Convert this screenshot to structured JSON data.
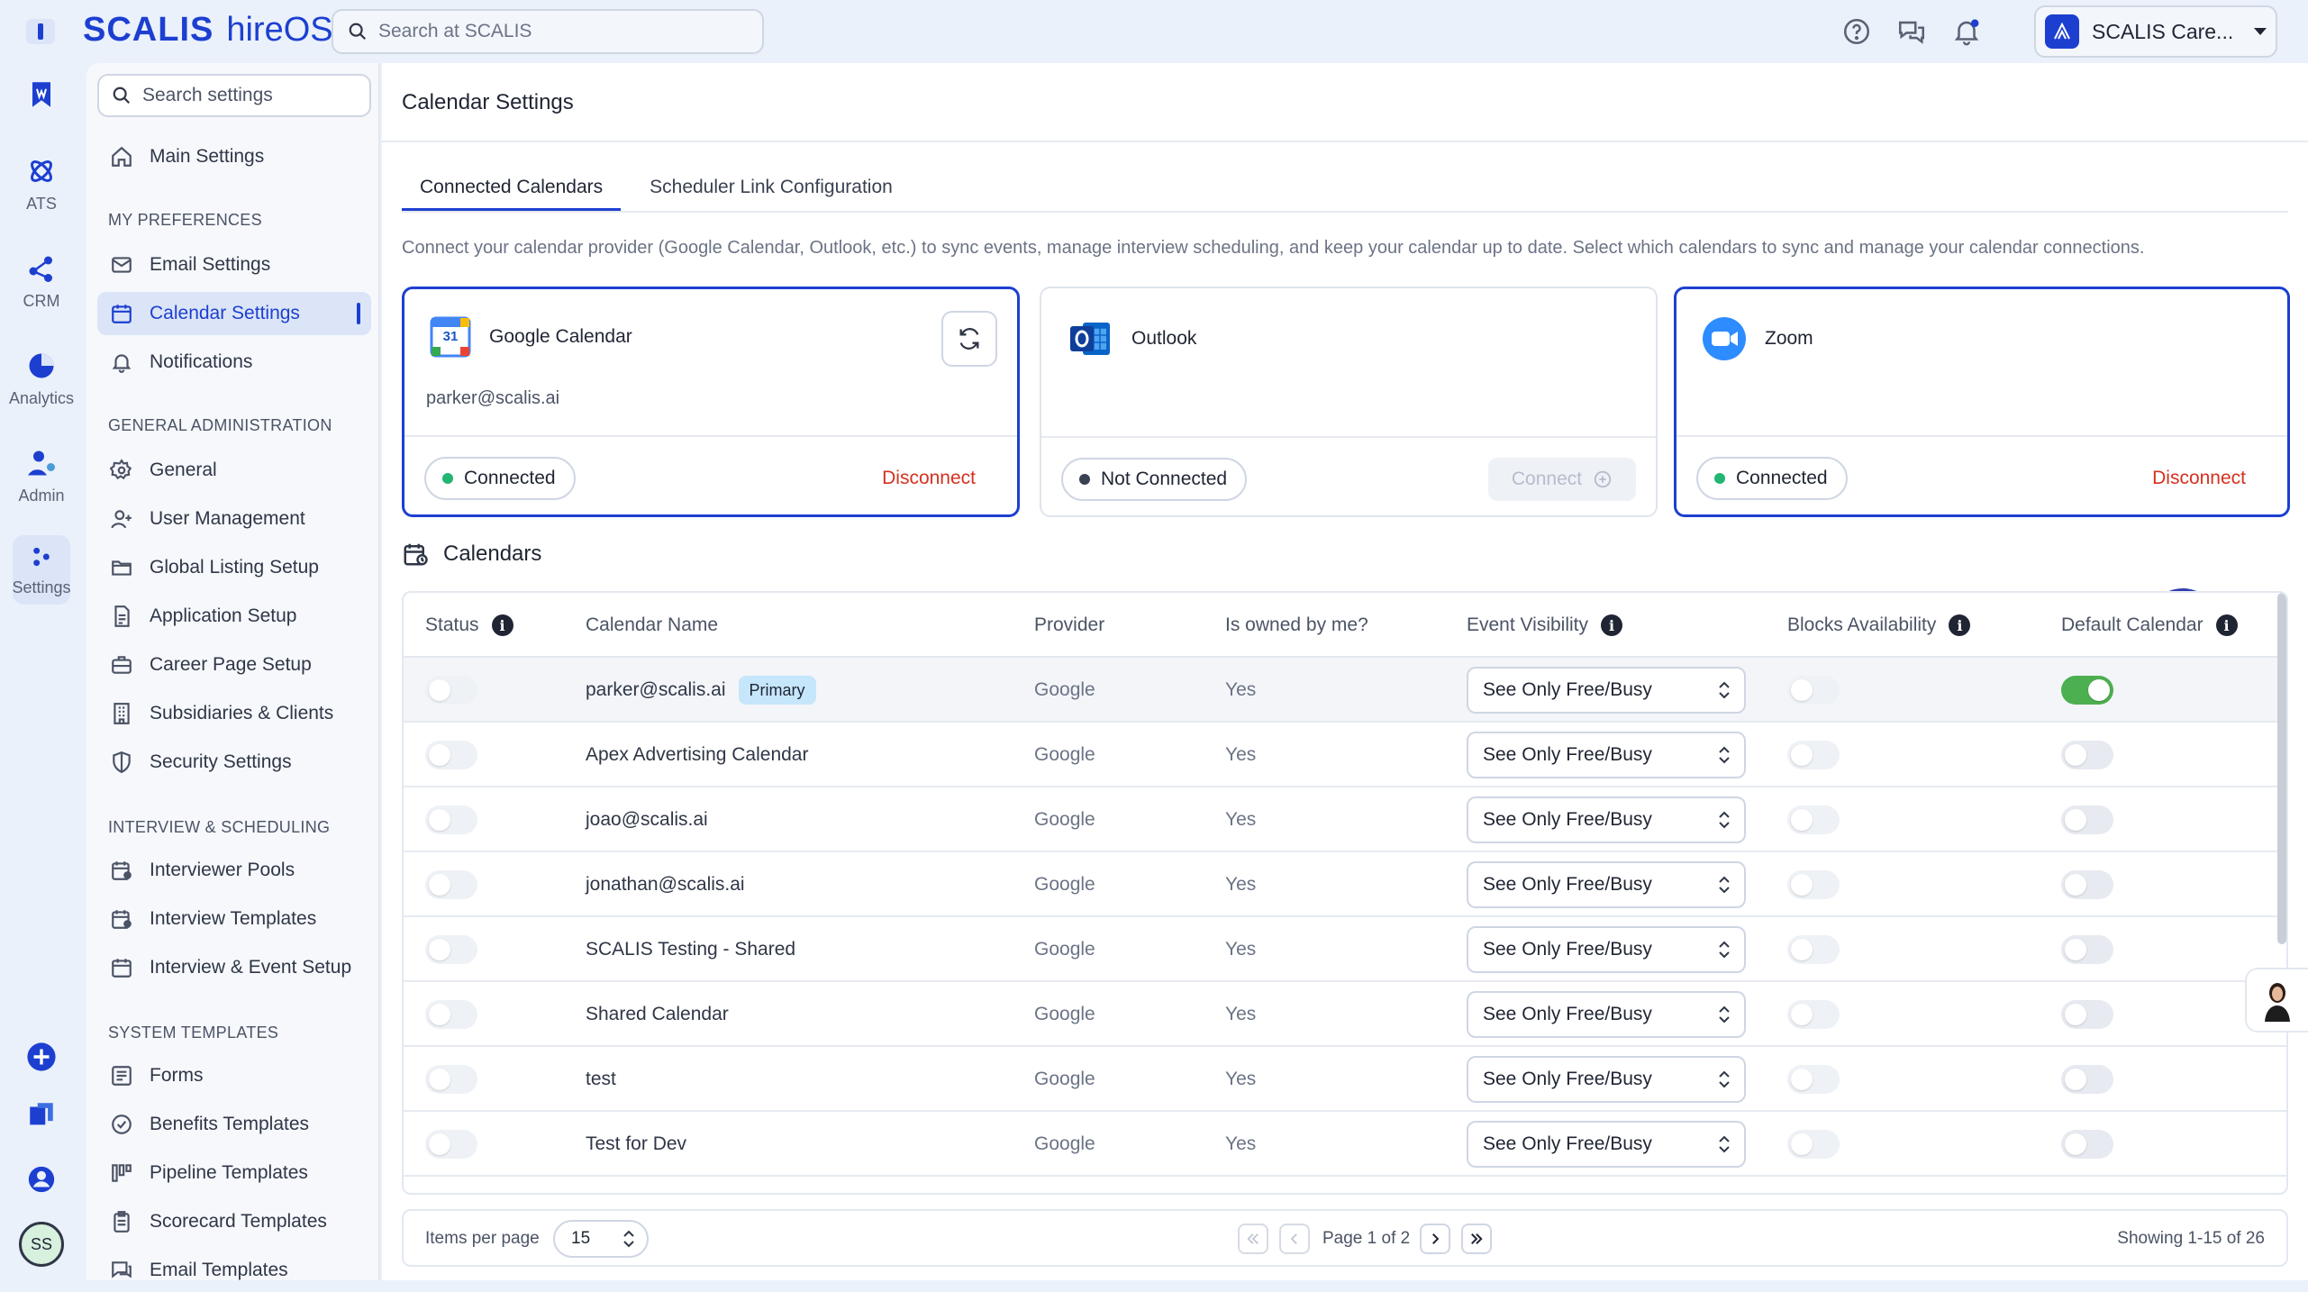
{
  "brand": {
    "name": "SCALIS",
    "product": "hireOS"
  },
  "top_search": {
    "placeholder": "Search at SCALIS"
  },
  "org": {
    "name": "SCALIS Care..."
  },
  "rail": {
    "ats": "ATS",
    "crm": "CRM",
    "analytics": "Analytics",
    "admin": "Admin",
    "settings": "Settings",
    "user_initials": "SS"
  },
  "settings_nav": {
    "search_placeholder": "Search settings",
    "main": "Main Settings",
    "sec_prefs": "MY PREFERENCES",
    "email": "Email Settings",
    "calendar": "Calendar Settings",
    "notifications": "Notifications",
    "sec_admin": "GENERAL ADMINISTRATION",
    "general": "General",
    "users": "User Management",
    "listing": "Global Listing Setup",
    "application": "Application Setup",
    "career": "Career Page Setup",
    "subsidiaries": "Subsidiaries & Clients",
    "security": "Security Settings",
    "sec_interview": "INTERVIEW & SCHEDULING",
    "pools": "Interviewer Pools",
    "int_templates": "Interview Templates",
    "event_setup": "Interview & Event Setup",
    "sec_system": "SYSTEM TEMPLATES",
    "forms": "Forms",
    "benefits": "Benefits Templates",
    "pipeline": "Pipeline Templates",
    "scorecard": "Scorecard Templates",
    "email_templates": "Email Templates"
  },
  "page": {
    "title": "Calendar Settings",
    "tab_connected": "Connected Calendars",
    "tab_scheduler": "Scheduler Link Configuration",
    "description": "Connect your calendar provider (Google Calendar, Outlook, etc.) to sync events, manage interview scheduling, and keep your calendar up to date. Select which calendars to sync and manage your calendar connections."
  },
  "providers": {
    "google": {
      "name": "Google Calendar",
      "email": "parker@scalis.ai",
      "status": "Connected",
      "action": "Disconnect",
      "icon_day": "31"
    },
    "outlook": {
      "name": "Outlook",
      "status": "Not Connected",
      "action": "Connect"
    },
    "zoom": {
      "name": "Zoom",
      "status": "Connected",
      "action": "Disconnect"
    }
  },
  "calendars": {
    "heading": "Calendars",
    "columns": {
      "status": "Status",
      "name": "Calendar Name",
      "provider": "Provider",
      "owned": "Is owned by me?",
      "visibility": "Event Visibility",
      "blocks": "Blocks Availability",
      "default": "Default Calendar"
    },
    "rows": [
      {
        "name": "parker@scalis.ai",
        "badge": "Primary",
        "provider": "Google",
        "owned": "Yes",
        "visibility": "See Only Free/Busy",
        "status_on": false,
        "blocks_on": false,
        "default_on": true
      },
      {
        "name": "Apex Advertising Calendar",
        "badge": "",
        "provider": "Google",
        "owned": "Yes",
        "visibility": "See Only Free/Busy",
        "status_on": false,
        "blocks_on": false,
        "default_on": false
      },
      {
        "name": "joao@scalis.ai",
        "badge": "",
        "provider": "Google",
        "owned": "Yes",
        "visibility": "See Only Free/Busy",
        "status_on": false,
        "blocks_on": false,
        "default_on": false
      },
      {
        "name": "jonathan@scalis.ai",
        "badge": "",
        "provider": "Google",
        "owned": "Yes",
        "visibility": "See Only Free/Busy",
        "status_on": false,
        "blocks_on": false,
        "default_on": false
      },
      {
        "name": "SCALIS Testing - Shared",
        "badge": "",
        "provider": "Google",
        "owned": "Yes",
        "visibility": "See Only Free/Busy",
        "status_on": false,
        "blocks_on": false,
        "default_on": false
      },
      {
        "name": "Shared Calendar",
        "badge": "",
        "provider": "Google",
        "owned": "Yes",
        "visibility": "See Only Free/Busy",
        "status_on": false,
        "blocks_on": false,
        "default_on": false
      },
      {
        "name": "test",
        "badge": "",
        "provider": "Google",
        "owned": "Yes",
        "visibility": "See Only Free/Busy",
        "status_on": false,
        "blocks_on": false,
        "default_on": false
      },
      {
        "name": "Test for Dev",
        "badge": "",
        "provider": "Google",
        "owned": "Yes",
        "visibility": "See Only Free/Busy",
        "status_on": false,
        "blocks_on": false,
        "default_on": false
      }
    ]
  },
  "pager": {
    "items_label": "Items per page",
    "per_page": "15",
    "page_label": "Page 1 of 2",
    "showing": "Showing 1-15 of 26"
  },
  "colors": {
    "brand": "#1d3fd0",
    "connected_dot": "#22b573",
    "danger": "#d4311f",
    "toggle_on": "#4caf50"
  }
}
